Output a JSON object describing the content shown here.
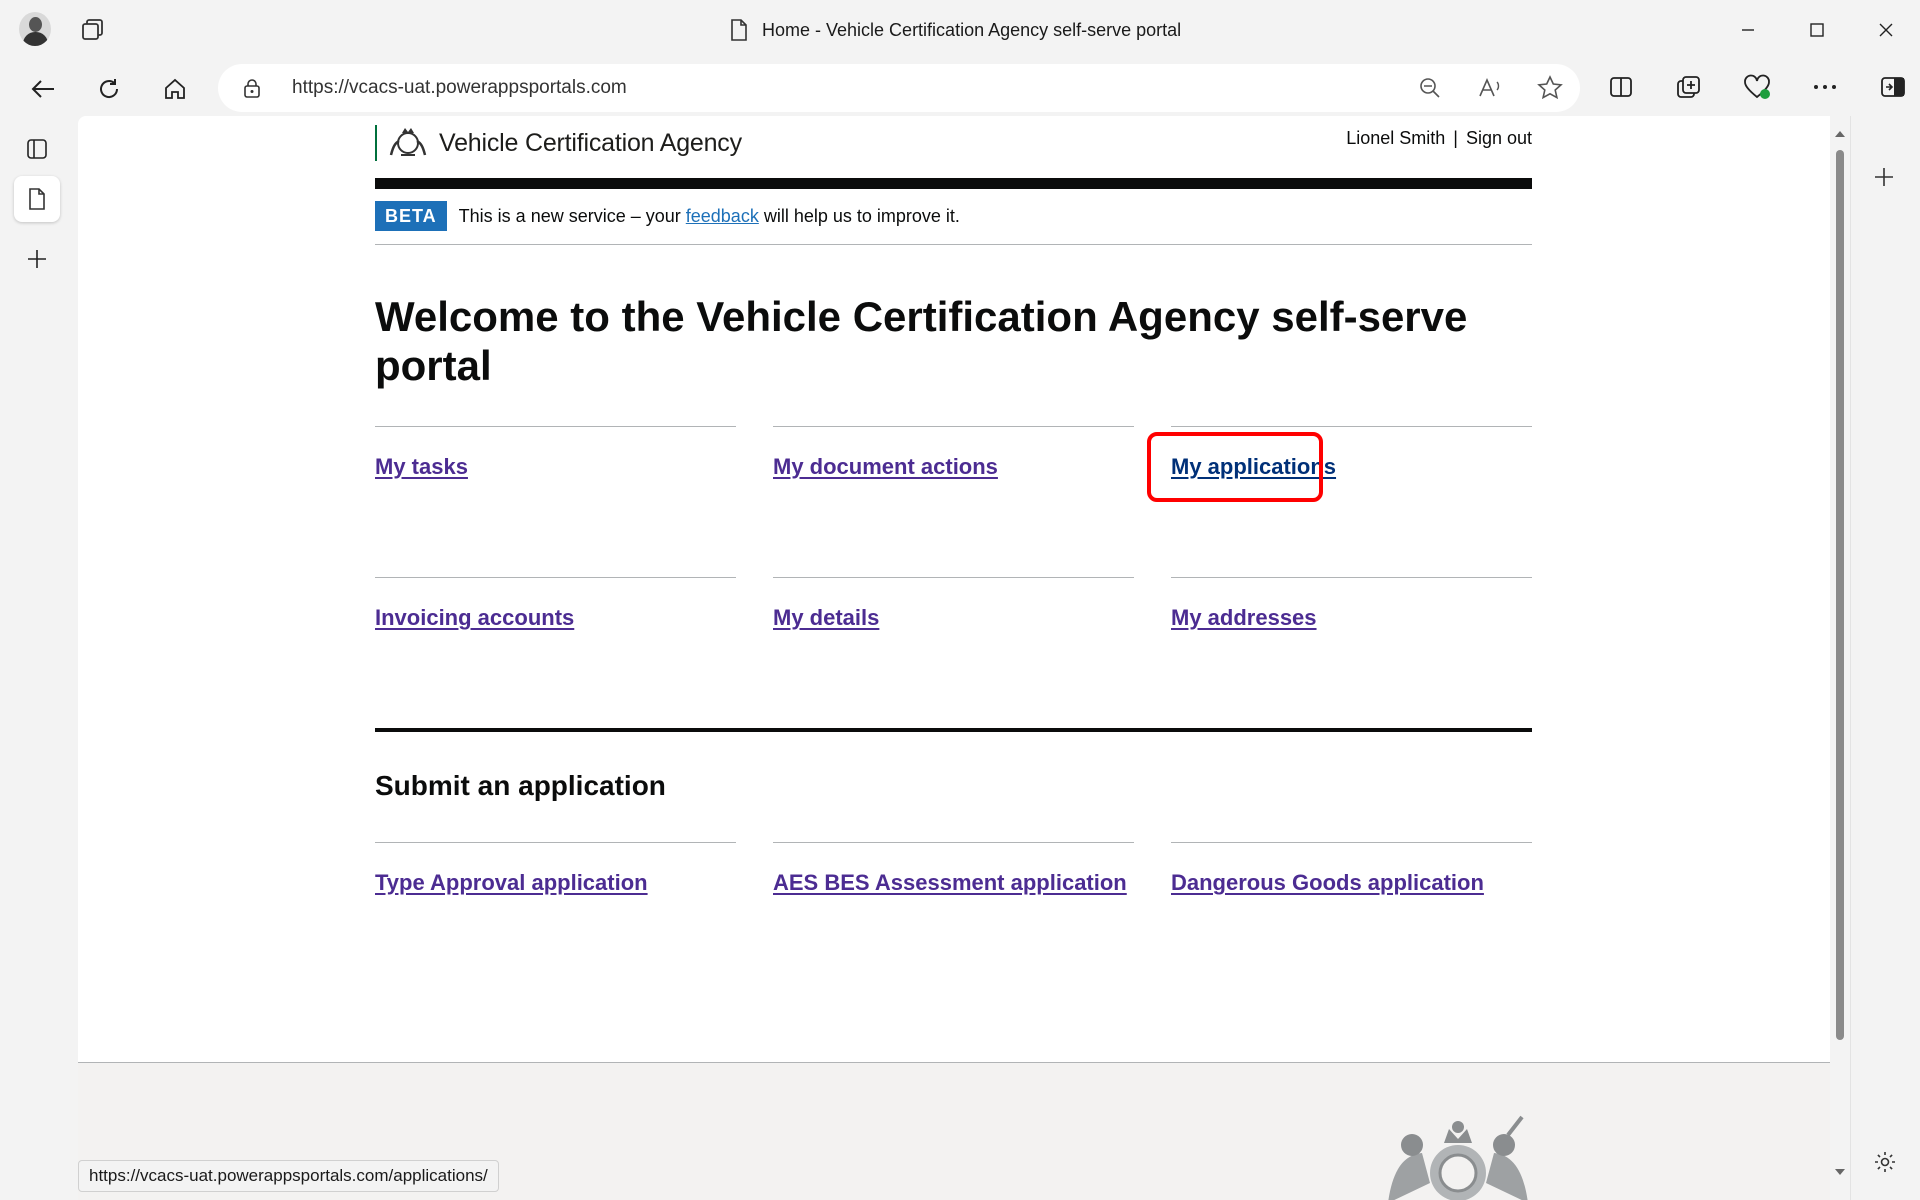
{
  "window": {
    "title": "Home - Vehicle Certification Agency self-serve portal"
  },
  "address_bar": {
    "url": "https://vcacs-uat.powerappsportals.com"
  },
  "status_bar": {
    "url": "https://vcacs-uat.powerappsportals.com/applications/"
  },
  "site": {
    "brand": "Vehicle Certification Agency",
    "user_name": "Lionel Smith",
    "separator": "|",
    "sign_out": "Sign out",
    "phase_tag": "BETA",
    "phase_before": "This is a new service – your ",
    "phase_link": "feedback",
    "phase_after": " will help us to improve it.",
    "heading": "Welcome to the Vehicle Certification Agency self-serve portal",
    "links": [
      {
        "label": "My tasks"
      },
      {
        "label": "My document actions"
      },
      {
        "label": "My applications"
      },
      {
        "label": "Invoicing accounts"
      },
      {
        "label": "My details"
      },
      {
        "label": "My addresses"
      }
    ],
    "submit_heading": "Submit an application",
    "submit_links": [
      {
        "label": "Type Approval application"
      },
      {
        "label": "AES BES Assessment application"
      },
      {
        "label": "Dangerous Goods application"
      }
    ]
  },
  "colors": {
    "link": "#4c2c92",
    "phase_tag": "#1d70b8",
    "highlight": "#ff0000"
  }
}
